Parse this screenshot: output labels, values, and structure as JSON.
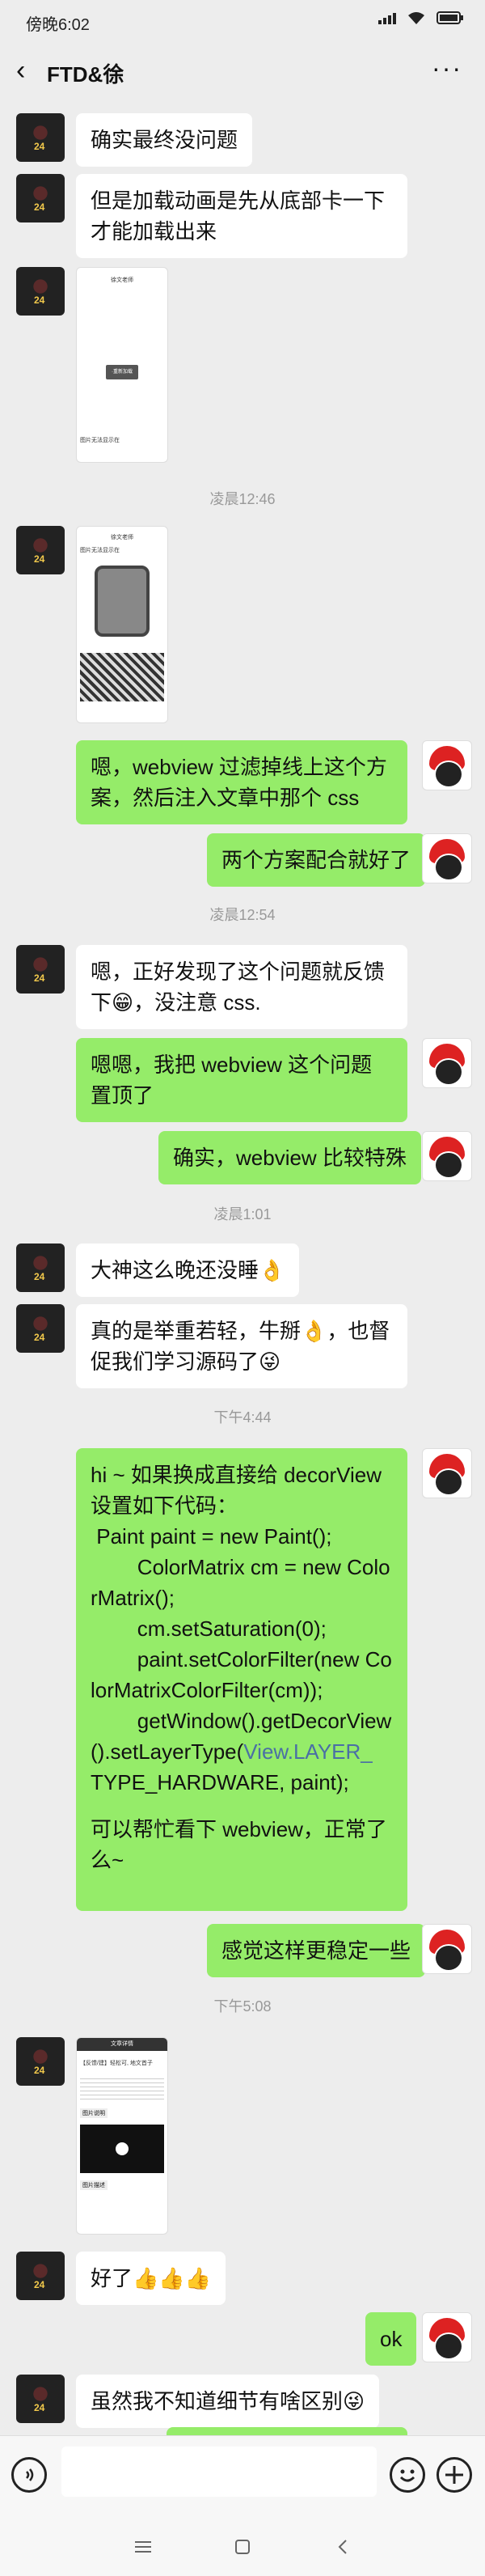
{
  "status": {
    "time": "傍晚6:02"
  },
  "header": {
    "back": "‹",
    "title": "FTD&徐",
    "more": "···"
  },
  "messages": {
    "m1": "确实最终没问题",
    "m2": "但是加载动画是先从底部卡一下才能加载出来",
    "t1": "凌晨12:46",
    "m3": "嗯，webview 过滤掉线上这个方案，然后注入文章中那个 css",
    "m4": "两个方案配合就好了",
    "t2": "凌晨12:54",
    "m5": "嗯，正好发现了这个问题就反馈下😁，没注意 css.",
    "m6": "嗯嗯，我把 webview 这个问题置顶了",
    "m7": "确实，webview 比较特殊",
    "t3": "凌晨1:01",
    "m8": "大神这么晚还没睡👌",
    "m9": "真的是举重若轻，牛掰👌，也督促我们学习源码了😜",
    "t4": "下午4:44",
    "m10_a": "hi ~ 如果换成直接给 decorView 设置如下代码：",
    "m10_b": " Paint paint = new Paint();",
    "m10_c": "        ColorMatrix cm = new ColorMatrix();",
    "m10_d": "        cm.setSaturation(0);",
    "m10_e": "        paint.setColorFilter(new ColorMatrixColorFilter(cm));",
    "m10_f": "        getWindow().getDecorView().setLayerType(",
    "m10_link": "View.LAYER_",
    "m10_g": "TYPE_HARDWARE, paint);",
    "m10_h": "可以帮忙看下 webview，正常了么~",
    "m11": "感觉这样更稳定一些",
    "t5": "下午5:08",
    "m12": "好了👍👍👍",
    "m13": "ok",
    "m14": "虽然我不知道细节有啥区别😜"
  },
  "screens": {
    "s1_title": "徐文老师",
    "s1_btn": "·重新加载",
    "s1_caption": "图片无法显示在",
    "s2_title": "徐文老师",
    "s2_caption": "图片无法显示在",
    "s3_title": "文章详情",
    "s3_sub": "【反馈/建】轻松可, 地文首子",
    "s3_tag": "图片说明",
    "s3_tag2": "图片描述"
  },
  "colors": {
    "bg": "#ededed",
    "bubble_right": "#95ec69",
    "bubble_left": "#ffffff",
    "link": "#4a6fa5"
  }
}
